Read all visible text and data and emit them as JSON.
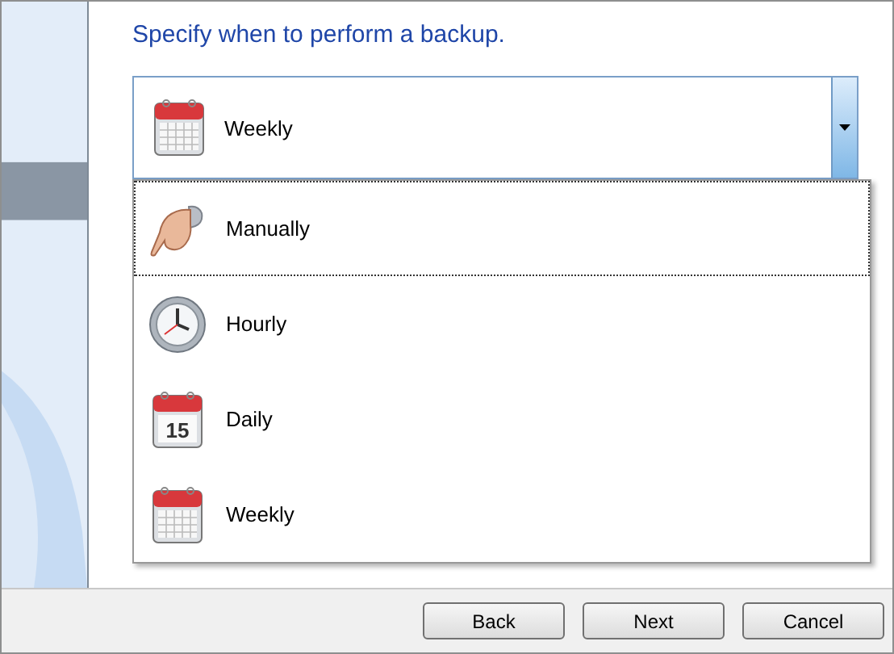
{
  "heading": "Specify when to perform a backup.",
  "schedule_combobox": {
    "value": "Weekly",
    "kind": "weekly",
    "expanded": true
  },
  "options": [
    {
      "label": "Manually",
      "kind": "manual",
      "focused": true
    },
    {
      "label": "Hourly",
      "kind": "hourly",
      "focused": false
    },
    {
      "label": "Daily",
      "kind": "daily",
      "icon_text": "15",
      "focused": false
    },
    {
      "label": "Weekly",
      "kind": "weekly",
      "focused": false
    }
  ],
  "buttons": [
    "Back",
    "Next",
    "Cancel"
  ]
}
